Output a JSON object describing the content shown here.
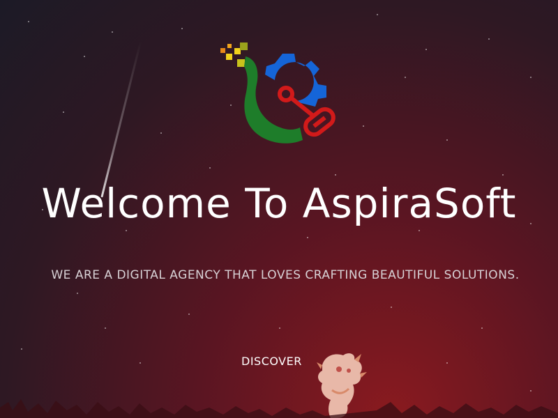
{
  "hero": {
    "title": "Welcome To AspiraSoft",
    "tagline": "WE ARE A DIGITAL AGENCY THAT LOVES CRAFTING BEAUTIFUL SOLUTIONS.",
    "discover_label": "DISCOVER"
  },
  "logo": {
    "icon": "gear-wrench-logo",
    "colors": {
      "green": "#1e7d2a",
      "blue": "#1565d8",
      "red": "#d21a1a",
      "yellow": "#f2d21c",
      "orange": "#e88a1a"
    }
  },
  "theme": {
    "background_top": "#1c1a26",
    "background_bottom": "#8a1a1f",
    "text": "#ffffff",
    "tagline_text": "#d8d2d6"
  }
}
